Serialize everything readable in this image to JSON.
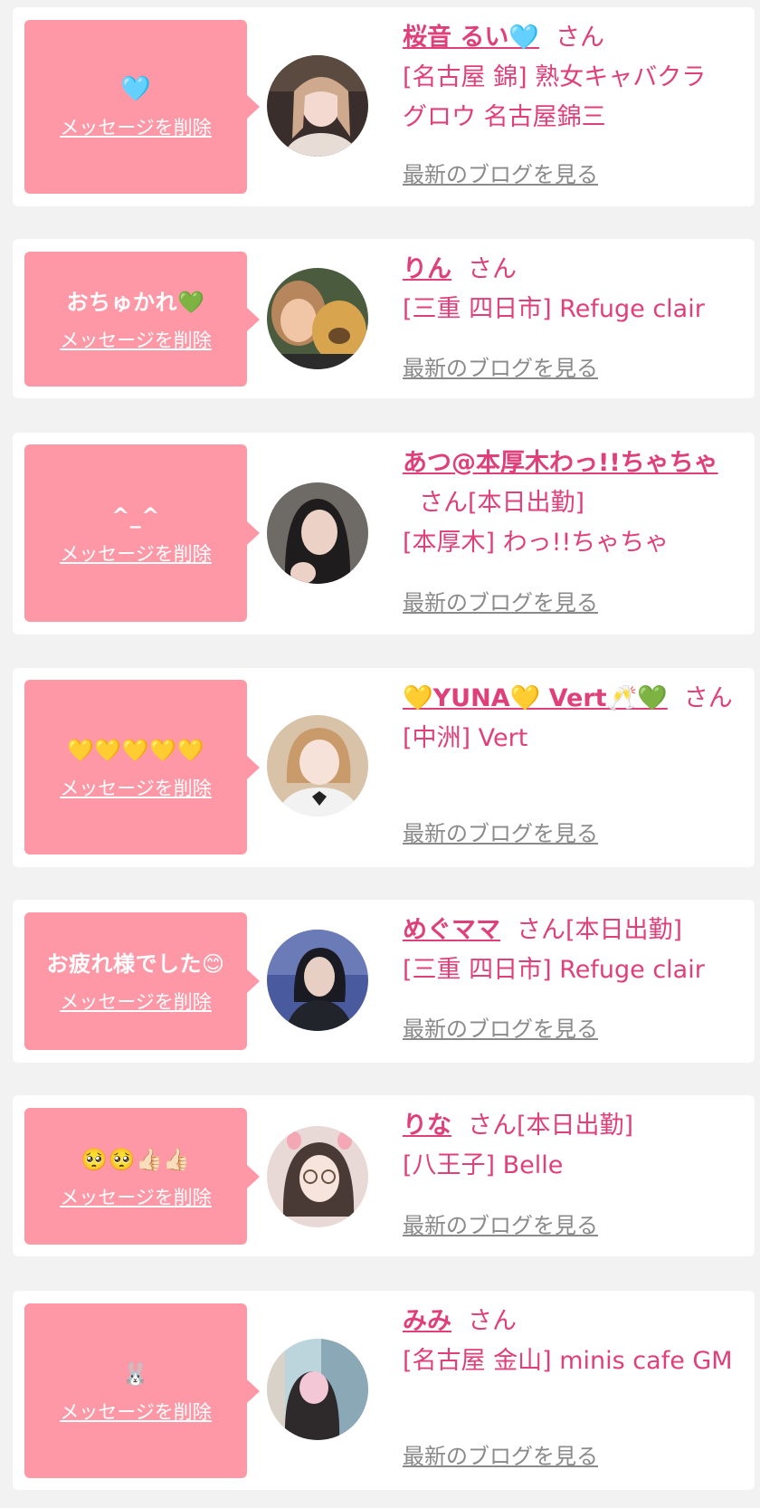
{
  "delete_label": "メッセージを削除",
  "blog_label": "最新のブログを見る",
  "san": "さん",
  "colors": {
    "page_bg": "#f2f2f2",
    "card_bg": "#ffffff",
    "bubble_bg": "#fe98a6",
    "accent_text": "#e0407a",
    "muted_text": "#8a8a8a"
  },
  "items": [
    {
      "message": "🩵",
      "name": "桜音 るい🩵",
      "status": "",
      "shop": "[名古屋 錦] 熟女キャバクラ グロウ 名古屋錦三",
      "avatar_icon": "profile-photo"
    },
    {
      "message": "おちゅかれ💚",
      "name": "りん",
      "status": "",
      "shop": "[三重 四日市] Refuge clair",
      "avatar_icon": "profile-photo"
    },
    {
      "message": "^_^",
      "name": "あつ@本厚木わっ!!ちゃちゃ",
      "status": "[本日出勤]",
      "shop": "[本厚木] わっ!!ちゃちゃ",
      "avatar_icon": "profile-photo"
    },
    {
      "message": "💛💛💛💛💛",
      "name": "💛YUNA💛 Vert🥂💚",
      "status": "",
      "shop": "[中洲] Vert",
      "avatar_icon": "profile-photo"
    },
    {
      "message": "お疲れ様でした😊",
      "name": "めぐママ",
      "status": "[本日出勤]",
      "shop": "[三重 四日市] Refuge clair",
      "avatar_icon": "profile-photo"
    },
    {
      "message": "🥺🥺👍🏻👍🏻",
      "name": "りな",
      "status": "[本日出勤]",
      "shop": "[八王子] Belle",
      "avatar_icon": "profile-photo"
    },
    {
      "message": "🐰",
      "name": "みみ",
      "status": "",
      "shop": "[名古屋 金山] minis cafe GM",
      "avatar_icon": "profile-photo"
    }
  ]
}
